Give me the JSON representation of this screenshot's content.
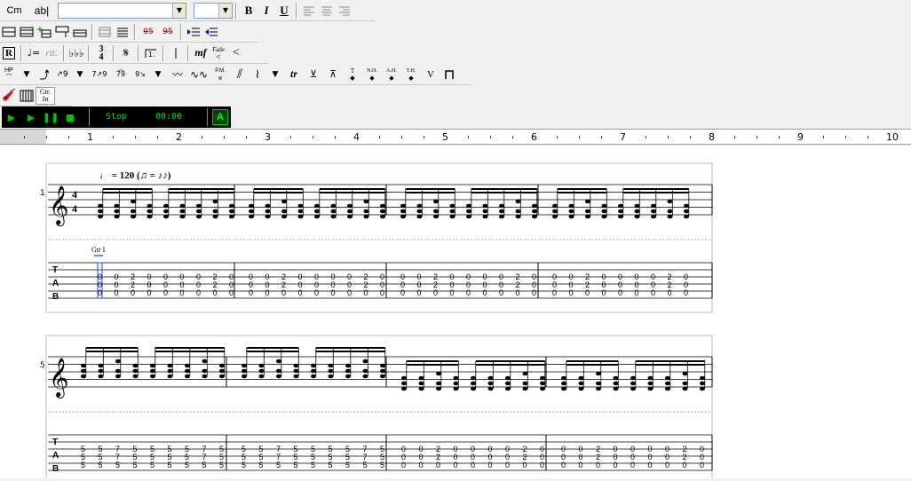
{
  "toolbar1": {
    "chord_label": "Cm",
    "text_label": "ab|",
    "font_select": "",
    "size_select": "",
    "bold": "B",
    "italic": "I",
    "underline": "U"
  },
  "toolbar3": {
    "r_label": "R",
    "quarter_equals": "♩=",
    "rit_label": "rit.",
    "flats_label": "♭♭♭",
    "time_sig_top": "3",
    "time_sig_bottom": "4",
    "segno": "𝄋",
    "mf_label": "mf",
    "fade_label": "Fade",
    "cresc_label": "<"
  },
  "toolbar4": {
    "hp_label": "HP",
    "pm_label": "P.M.",
    "tr_label": "tr",
    "t_label": "T",
    "nh_label": "N.H.",
    "ah_label": "A.H.",
    "th_label": "T.H.",
    "v_label": "V"
  },
  "toolbar5": {
    "gtr_in_label": "Gtr. In"
  },
  "player": {
    "status": "Stop",
    "time": "00:00",
    "a_label": "A"
  },
  "ruler": {
    "numbers": [
      "1",
      "2",
      "3",
      "4",
      "5",
      "6",
      "7",
      "8",
      "9",
      "10"
    ]
  },
  "score": {
    "tempo": "♩ = 120 (♫ = ♪♪)",
    "system1_number": "1",
    "system2_number": "5",
    "time_sig_top": "4",
    "time_sig_bottom": "4",
    "guitar_label": "Gtr I",
    "tab_letters": [
      "T",
      "A",
      "B"
    ],
    "system1_tab": {
      "line1": [
        "0",
        "0",
        "2",
        "0",
        "0",
        "0",
        "0",
        "2",
        "0"
      ],
      "line2": [
        "0",
        "0",
        "2",
        "0",
        "0",
        "0",
        "0",
        "2",
        "0"
      ],
      "line3": [
        "0",
        "0",
        "0",
        "0",
        "0",
        "0",
        "0",
        "0",
        "0"
      ]
    },
    "system2_tab_a": {
      "line1": [
        "5",
        "5",
        "7",
        "5",
        "5",
        "5",
        "5",
        "7",
        "5"
      ],
      "line2": [
        "5",
        "5",
        "7",
        "5",
        "5",
        "5",
        "5",
        "7",
        "5"
      ],
      "line3": [
        "5",
        "5",
        "5",
        "5",
        "5",
        "5",
        "5",
        "5",
        "5"
      ]
    },
    "system2_tab_b": {
      "line1": [
        "0",
        "0",
        "2",
        "0",
        "0",
        "0",
        "0",
        "2",
        "0"
      ],
      "line2": [
        "0",
        "0",
        "2",
        "0",
        "0",
        "0",
        "0",
        "2",
        "0"
      ],
      "line3": [
        "0",
        "0",
        "0",
        "0",
        "0",
        "0",
        "0",
        "0",
        "0"
      ]
    }
  }
}
